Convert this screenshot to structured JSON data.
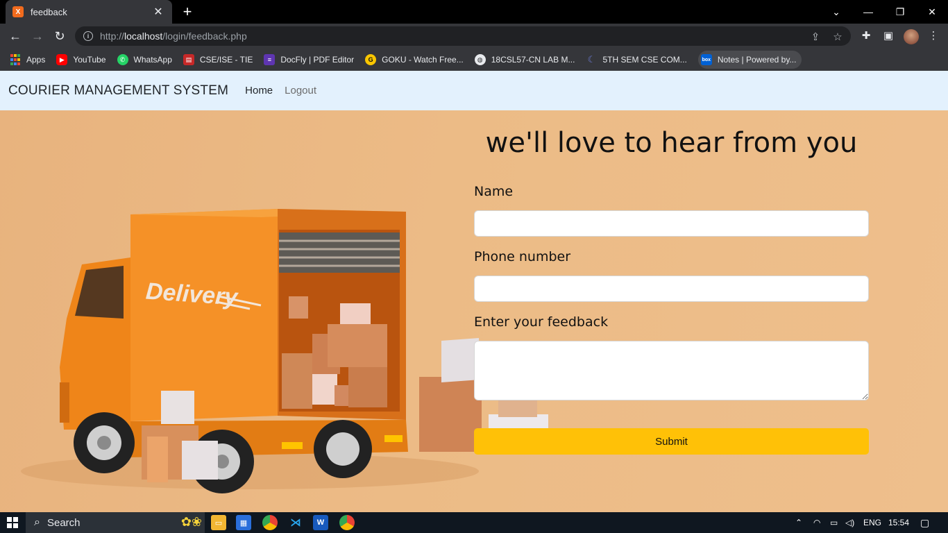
{
  "browser": {
    "tab_title": "feedback",
    "tab_favicon": "X",
    "url_prefix": "http://",
    "url_host": "localhost",
    "url_path": "/login/feedback.php",
    "bookmarks": [
      {
        "label": "Apps",
        "icon": "apps-grid-icon",
        "color": "#4285f4"
      },
      {
        "label": "YouTube",
        "icon": "youtube-icon",
        "color": "#ff0000"
      },
      {
        "label": "WhatsApp",
        "icon": "whatsapp-icon",
        "color": "#25d366"
      },
      {
        "label": "CSE/ISE - TIE",
        "icon": "document-icon",
        "color": "#c62828"
      },
      {
        "label": "DocFly | PDF Editor",
        "icon": "docfly-icon",
        "color": "#5e35b1"
      },
      {
        "label": "GOKU - Watch Free...",
        "icon": "goku-icon",
        "color": "#f9c600"
      },
      {
        "label": "18CSL57-CN LAB M...",
        "icon": "globe-icon",
        "color": "#9aa0a6"
      },
      {
        "label": "5TH SEM CSE COM...",
        "icon": "moon-icon",
        "color": "#3f51b5"
      },
      {
        "label": "Notes | Powered by...",
        "icon": "box-icon",
        "color": "#0061d5"
      }
    ]
  },
  "site": {
    "brand": "COURIER MANAGEMENT SYSTEM",
    "nav": {
      "home": "Home",
      "logout": "Logout"
    },
    "hero_image": {
      "truck_text": "Delivery"
    },
    "form": {
      "headline": "we'll love to hear from you",
      "name_label": "Name",
      "name_value": "",
      "phone_label": "Phone number",
      "phone_value": "",
      "feedback_label": "Enter your feedback",
      "feedback_value": "",
      "submit_label": "Submit"
    }
  },
  "taskbar": {
    "search_placeholder": "Search",
    "language": "ENG",
    "time": "15:54"
  },
  "colors": {
    "navbar_bg": "#e3f1fd",
    "hero_bg": "#ebb982",
    "submit_bg": "#ffc107",
    "truck_orange": "#f08a1c"
  }
}
